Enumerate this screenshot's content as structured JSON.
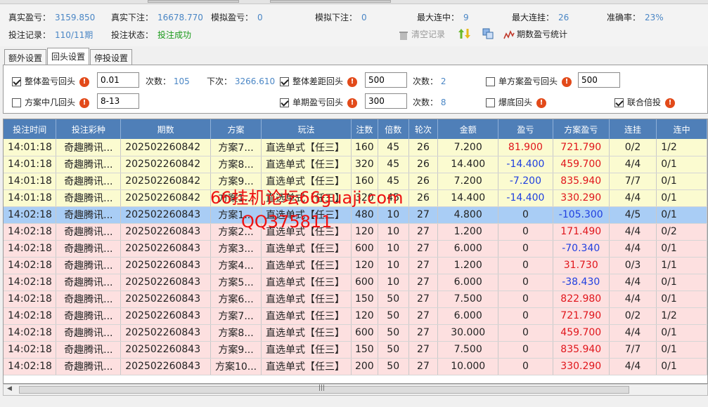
{
  "stats": {
    "real_profit_label": "真实盈亏：",
    "real_profit_value": "3159.850",
    "real_bet_label": "真实下注：",
    "real_bet_value": "16678.770",
    "sim_profit_label": "模拟盈亏：",
    "sim_profit_value": "0",
    "sim_bet_label": "模拟下注：",
    "sim_bet_value": "0",
    "max_win_label": "最大连中：",
    "max_win_value": "9",
    "max_lose_label": "最大连挂：",
    "max_lose_value": "26",
    "accuracy_label": "准确率：",
    "accuracy_value": "23%",
    "record_label": "投注记录：",
    "record_value": "110/11期",
    "status_label": "投注状态：",
    "status_value": "投注成功"
  },
  "toolbar": {
    "clear_label": "清空记录",
    "period_stats_label": "期数盈亏统计"
  },
  "tabs": [
    {
      "label": "额外设置"
    },
    {
      "label": "回头设置"
    },
    {
      "label": "停投设置"
    }
  ],
  "settings": {
    "overall_profit_label": "整体盈亏回头",
    "overall_profit_input": "0.01",
    "times_label": "次数：",
    "times_value1": "105",
    "next_label": "下次：",
    "next_value": "3266.610",
    "overall_gap_label": "整体差距回头",
    "overall_gap_input": "500",
    "times_value2": "2",
    "single_profit_label": "单方案盈亏回头",
    "single_profit_input": "500",
    "plan_hits_label": "方案中几回头",
    "plan_hits_input": "8-13",
    "single_period_label": "单期盈亏回头",
    "single_period_input": "300",
    "times_value3": "8",
    "bust_label": "爆底回头",
    "combined_label": "联合倍投"
  },
  "table": {
    "headers": [
      "投注时间",
      "投注彩种",
      "期数",
      "方案",
      "玩法",
      "注数",
      "倍数",
      "轮次",
      "金额",
      "盈亏",
      "方案盈亏",
      "连挂",
      "连中"
    ],
    "rows": [
      [
        "14:01:18",
        "奇趣腾讯...",
        "202502260842",
        "方案7...",
        "直选单式【任三】",
        "160",
        "45",
        "26",
        "7.200",
        "81.900",
        "721.790",
        "0/2",
        "1/2"
      ],
      [
        "14:01:18",
        "奇趣腾讯...",
        "202502260842",
        "方案8...",
        "直选单式【任三】",
        "320",
        "45",
        "26",
        "14.400",
        "-14.400",
        "459.700",
        "4/4",
        "0/1"
      ],
      [
        "14:01:18",
        "奇趣腾讯...",
        "202502260842",
        "方案9...",
        "直选单式【任三】",
        "160",
        "45",
        "26",
        "7.200",
        "-7.200",
        "835.940",
        "7/7",
        "0/1"
      ],
      [
        "14:01:18",
        "奇趣腾讯...",
        "202502260842",
        "方案1...",
        "直选单式【任三】",
        "320",
        "45",
        "26",
        "14.400",
        "-14.400",
        "330.290",
        "4/4",
        "0/1"
      ],
      [
        "14:02:18",
        "奇趣腾讯...",
        "202502260843",
        "方案1...",
        "直选单式【任三】",
        "480",
        "10",
        "27",
        "4.800",
        "0",
        "-105.300",
        "4/5",
        "0/1"
      ],
      [
        "14:02:18",
        "奇趣腾讯...",
        "202502260843",
        "方案2...",
        "直选单式【任三】",
        "120",
        "10",
        "27",
        "1.200",
        "0",
        "171.490",
        "4/4",
        "0/2"
      ],
      [
        "14:02:18",
        "奇趣腾讯...",
        "202502260843",
        "方案3...",
        "直选单式【任三】",
        "600",
        "10",
        "27",
        "6.000",
        "0",
        "-70.340",
        "4/4",
        "0/1"
      ],
      [
        "14:02:18",
        "奇趣腾讯...",
        "202502260843",
        "方案4...",
        "直选单式【任三】",
        "120",
        "10",
        "27",
        "1.200",
        "0",
        "31.730",
        "0/3",
        "1/1"
      ],
      [
        "14:02:18",
        "奇趣腾讯...",
        "202502260843",
        "方案5...",
        "直选单式【任三】",
        "600",
        "10",
        "27",
        "6.000",
        "0",
        "-38.430",
        "4/4",
        "0/1"
      ],
      [
        "14:02:18",
        "奇趣腾讯...",
        "202502260843",
        "方案6...",
        "直选单式【任三】",
        "150",
        "50",
        "27",
        "7.500",
        "0",
        "822.980",
        "4/4",
        "0/1"
      ],
      [
        "14:02:18",
        "奇趣腾讯...",
        "202502260843",
        "方案7...",
        "直选单式【任三】",
        "120",
        "50",
        "27",
        "6.000",
        "0",
        "721.790",
        "0/2",
        "1/2"
      ],
      [
        "14:02:18",
        "奇趣腾讯...",
        "202502260843",
        "方案8...",
        "直选单式【任三】",
        "600",
        "50",
        "27",
        "30.000",
        "0",
        "459.700",
        "4/4",
        "0/1"
      ],
      [
        "14:02:18",
        "奇趣腾讯...",
        "202502260843",
        "方案9...",
        "直选单式【任三】",
        "150",
        "50",
        "27",
        "7.500",
        "0",
        "835.940",
        "7/7",
        "0/1"
      ],
      [
        "14:02:18",
        "奇趣腾讯...",
        "202502260843",
        "方案10...",
        "直选单式【任三】",
        "200",
        "50",
        "27",
        "10.000",
        "0",
        "330.290",
        "4/4",
        "0/1"
      ]
    ]
  },
  "watermark": {
    "line1": "66挂机论坛66guaji.com",
    "line2": "QQ375811"
  },
  "colors": {
    "header_bg": "#4f7fb8",
    "row_yellow": "#fbfbd0",
    "row_pink": "#fde0e0",
    "row_selected": "#a9cdf5",
    "positive": "#e0151b",
    "negative": "#1f3fe0",
    "value_blue": "#4a86c5",
    "success_green": "#1a9a1a"
  }
}
